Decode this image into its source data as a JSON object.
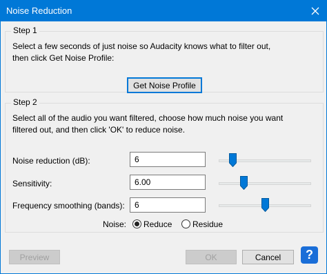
{
  "window": {
    "title": "Noise Reduction"
  },
  "step1": {
    "title": "Step 1",
    "line1": "Select a few seconds of just noise so Audacity knows what to filter out,",
    "line2": "then click Get Noise Profile:",
    "button": "Get Noise Profile"
  },
  "step2": {
    "title": "Step 2",
    "line1": "Select all of the audio you want filtered, choose how much noise you want",
    "line2": "filtered out, and then click 'OK' to reduce noise.",
    "params": [
      {
        "label": "Noise reduction (dB):",
        "value": "6",
        "slider_fraction": 0.17
      },
      {
        "label": "Sensitivity:",
        "value": "6.00",
        "slider_fraction": 0.27
      },
      {
        "label": "Frequency smoothing (bands):",
        "value": "6",
        "slider_fraction": 0.51
      }
    ],
    "noise": {
      "label": "Noise:",
      "options": [
        {
          "label": "Reduce",
          "selected": true
        },
        {
          "label": "Residue",
          "selected": false
        }
      ]
    }
  },
  "footer": {
    "preview": "Preview",
    "ok": "OK",
    "cancel": "Cancel",
    "help": "?"
  },
  "colors": {
    "titlebar": "#0078d7",
    "accent": "#0078d7"
  }
}
